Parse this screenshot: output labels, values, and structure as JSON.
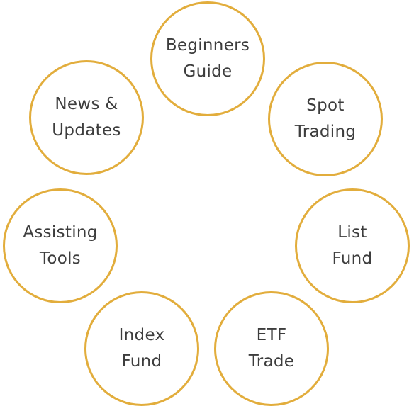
{
  "accent_color": "#e2ad3c",
  "text_color": "#3d3d3d",
  "menu": {
    "beginners_guide": {
      "line1": "Beginners",
      "line2": "Guide"
    },
    "spot_trading": {
      "line1": "Spot",
      "line2": "Trading"
    },
    "news_updates": {
      "line1": "News &",
      "line2": "Updates"
    },
    "assisting_tools": {
      "line1": "Assisting",
      "line2": "Tools"
    },
    "list_fund": {
      "line1": "List",
      "line2": "Fund"
    },
    "index_fund": {
      "line1": "Index",
      "line2": "Fund"
    },
    "etf_trade": {
      "line1": "ETF",
      "line2": "Trade"
    }
  }
}
